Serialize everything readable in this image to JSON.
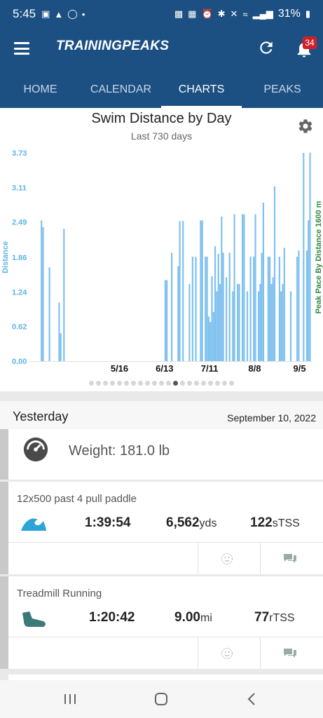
{
  "status": {
    "time": "5:45",
    "battery": "31%"
  },
  "app": {
    "logo": "TRAININGPEAKS",
    "notification_count": "34"
  },
  "tabs": [
    {
      "label": "HOME",
      "active": false
    },
    {
      "label": "CALENDAR",
      "active": false
    },
    {
      "label": "CHARTS",
      "active": true
    },
    {
      "label": "PEAKS",
      "active": false
    }
  ],
  "chart": {
    "title": "Swim Distance by Day",
    "subtitle": "Last 730 days",
    "ylabel": "Distance",
    "y2label": "Peak Pace By Distance 1600 m",
    "yticks": [
      "0.00",
      "0.62",
      "1.24",
      "1.86",
      "2.49",
      "3.11",
      "3.73"
    ],
    "xticks": [
      "5/16",
      "6/13",
      "7/11",
      "8/8",
      "9/5"
    ],
    "page_dots": 21,
    "active_dot": 12
  },
  "chart_data": {
    "type": "bar",
    "title": "Swim Distance by Day",
    "xlabel": "",
    "ylabel": "Distance",
    "ylim": [
      0,
      3.73
    ],
    "xlim_days": [
      0,
      230
    ],
    "x_tick_days": {
      "5/16": 56,
      "6/13": 84,
      "7/11": 112,
      "8/8": 140,
      "9/5": 168
    },
    "bars": [
      {
        "day": 7,
        "value": 2.52
      },
      {
        "day": 8,
        "value": 2.4
      },
      {
        "day": 12,
        "value": 1.68
      },
      {
        "day": 18,
        "value": 1.05
      },
      {
        "day": 19,
        "value": 0.5
      },
      {
        "day": 21,
        "value": 2.37
      },
      {
        "day": 84,
        "value": 1.45
      },
      {
        "day": 85,
        "value": 1.45
      },
      {
        "day": 88,
        "value": 1.94
      },
      {
        "day": 92,
        "value": 1.7
      },
      {
        "day": 93,
        "value": 2.51
      },
      {
        "day": 95,
        "value": 2.51
      },
      {
        "day": 99,
        "value": 1.38
      },
      {
        "day": 101,
        "value": 1.87
      },
      {
        "day": 103,
        "value": 1.87
      },
      {
        "day": 106,
        "value": 2.52
      },
      {
        "day": 107,
        "value": 2.52
      },
      {
        "day": 109,
        "value": 1.87
      },
      {
        "day": 110,
        "value": 1.87
      },
      {
        "day": 111,
        "value": 0.8
      },
      {
        "day": 112,
        "value": 0.7
      },
      {
        "day": 113,
        "value": 1.52
      },
      {
        "day": 114,
        "value": 0.88
      },
      {
        "day": 115,
        "value": 2.06
      },
      {
        "day": 116,
        "value": 1.25
      },
      {
        "day": 117,
        "value": 1.92
      },
      {
        "day": 118,
        "value": 1.38
      },
      {
        "day": 119,
        "value": 2.59
      },
      {
        "day": 120,
        "value": 1.94
      },
      {
        "day": 122,
        "value": 1.5
      },
      {
        "day": 124,
        "value": 1.94
      },
      {
        "day": 126,
        "value": 1.25
      },
      {
        "day": 127,
        "value": 2.63
      },
      {
        "day": 129,
        "value": 1.38
      },
      {
        "day": 130,
        "value": 1.38
      },
      {
        "day": 132,
        "value": 2.63
      },
      {
        "day": 133,
        "value": 2.63
      },
      {
        "day": 135,
        "value": 1.25
      },
      {
        "day": 137,
        "value": 1.87
      },
      {
        "day": 139,
        "value": 1.87
      },
      {
        "day": 140,
        "value": 2.63
      },
      {
        "day": 142,
        "value": 1.25
      },
      {
        "day": 143,
        "value": 1.38
      },
      {
        "day": 144,
        "value": 1.94
      },
      {
        "day": 145,
        "value": 2.84
      },
      {
        "day": 148,
        "value": 1.87
      },
      {
        "day": 149,
        "value": 1.87
      },
      {
        "day": 150,
        "value": 1.38
      },
      {
        "day": 151,
        "value": 1.5
      },
      {
        "day": 152,
        "value": 3.13
      },
      {
        "day": 155,
        "value": 1.87
      },
      {
        "day": 156,
        "value": 1.25
      },
      {
        "day": 157,
        "value": 1.38
      },
      {
        "day": 158,
        "value": 2.03
      },
      {
        "day": 162,
        "value": 1.25
      },
      {
        "day": 166,
        "value": 1.87
      },
      {
        "day": 167,
        "value": 1.98
      },
      {
        "day": 170,
        "value": 3.73
      },
      {
        "day": 172,
        "value": 1.98
      },
      {
        "day": 173,
        "value": 2.52
      },
      {
        "day": 174,
        "value": 3.73
      }
    ],
    "bar_color": "#7fc1ef"
  },
  "day_section": {
    "label": "Yesterday",
    "date": "September 10, 2022"
  },
  "weight": {
    "text": "Weight: 181.0 lb"
  },
  "workouts": [
    {
      "title": "12x500 past 4 pull paddle",
      "duration": "1:39:54",
      "distance": "6,562",
      "distance_unit": "yds",
      "tss": "122",
      "tss_unit": "sTSS",
      "icon": "swim-wave-icon",
      "color": "#2ca5d6"
    },
    {
      "title": "Treadmill Running",
      "duration": "1:20:42",
      "distance": "9.00",
      "distance_unit": "mi",
      "tss": "77",
      "tss_unit": "rTSS",
      "icon": "run-shoe-icon",
      "color": "#3a7a78"
    }
  ],
  "colors": {
    "brand": "#1c5083",
    "axis_label": "#5bb4e8",
    "y2_label": "#2e8a3c"
  }
}
